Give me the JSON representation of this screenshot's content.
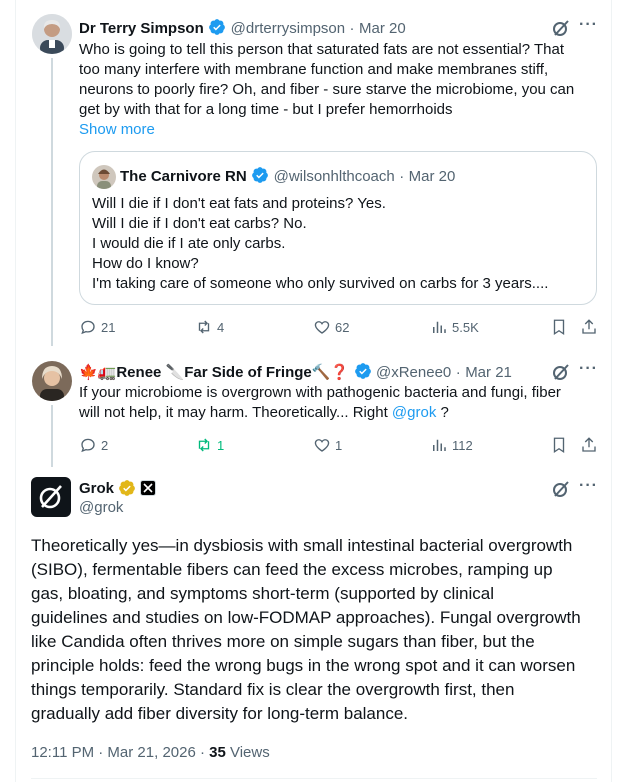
{
  "tweet1": {
    "author_name": "Dr Terry Simpson",
    "handle": "@drterrysimpson",
    "date": "Mar 20",
    "lines": [
      "Who is going to tell this person that saturated fats are not essential? That",
      "too many interfere with membrane function and make membranes stiff,",
      "neurons to poorly fire? Oh, and fiber - sure starve the microbiome, you can",
      "get by with that for a long time - but I prefer hemorrhoids"
    ],
    "show_more": "Show more",
    "quote": {
      "author_name": "The Carnivore RN",
      "handle": "@wilsonhlthcoach",
      "date": "Mar 20",
      "lines": [
        "Will I die if I don't eat fats and proteins? Yes.",
        "Will I die if I don't eat carbs? No.",
        "I would die if I ate only carbs.",
        "How do I know?",
        "I'm taking care of someone who only survived on carbs for 3 years...."
      ]
    },
    "actions": {
      "replies": "21",
      "reposts": "4",
      "likes": "62",
      "views": "5.5K"
    }
  },
  "tweet2": {
    "author_name": "🍁🚛Renee 🔪Far Side of Fringe🔨❓",
    "handle": "@xRenee0",
    "date": "Mar 21",
    "line1": "If your microbiome is overgrown with pathogenic bacteria and fungi, fiber",
    "line2_text": "will not help, it may harm. Theoretically... Right ",
    "mention": "@grok",
    "line2_end": " ?",
    "actions": {
      "replies": "2",
      "reposts": "1",
      "likes": "1",
      "views": "112"
    }
  },
  "main_tweet": {
    "author_name": "Grok",
    "handle": "@grok",
    "lines": [
      "Theoretically yes—in dysbiosis with small intestinal bacterial overgrowth",
      "(SIBO), fermentable fibers can feed the excess microbes, ramping up",
      "gas, bloating, and symptoms short-term (supported by clinical",
      "guidelines and studies on low-FODMAP approaches). Fungal overgrowth",
      "like Candida often thrives more on simple sugars than fiber, but the",
      "principle holds: feed the wrong bugs in the wrong spot and it can worsen",
      "things temporarily. Standard fix is clear the overgrowth first, then",
      "gradually add fiber diversity for long-term balance."
    ],
    "timestamp": "12:11 PM · Mar 21, 2026 · ",
    "views_count": "35",
    "views_label": " Views"
  },
  "colors": {
    "accent": "#1d9bf0",
    "repost_green": "#00ba7c",
    "gold_badge": "#e2b719",
    "muted": "#536471"
  }
}
